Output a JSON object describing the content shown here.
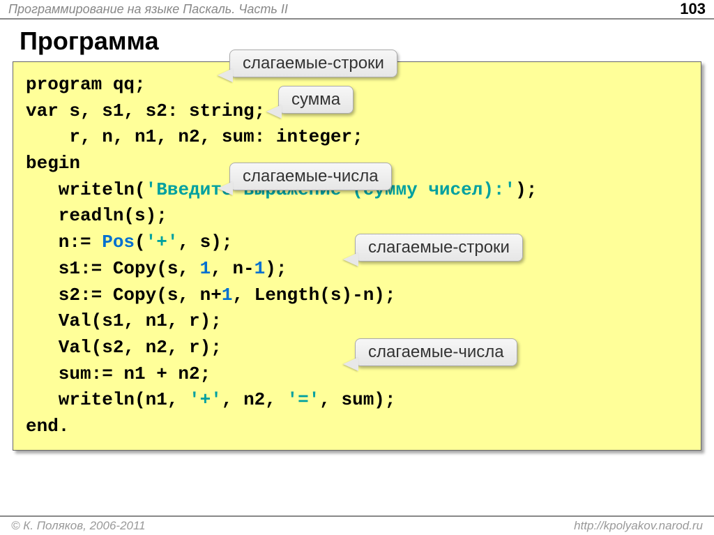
{
  "header": {
    "course": "Программирование на языке Паскаль. Часть II",
    "page": "103"
  },
  "title": "Программа",
  "code": {
    "l1": "program qq;",
    "l2": "var s, s1, s2: string;",
    "l3": "    r, n, n1, n2, sum: integer;",
    "l4": "begin",
    "l5a": "   writeln(",
    "l5b": "'Введите выражение (сумму чисел):'",
    "l5c": ");",
    "l6": "   readln(s);",
    "l7a": "   n:= ",
    "l7b": "Pos",
    "l7c": "(",
    "l7d": "'+'",
    "l7e": ", s);",
    "l8a": "   s1:= Copy(s, ",
    "l8b": "1",
    "l8c": ", n-",
    "l8d": "1",
    "l8e": ");",
    "l9a": "   s2:= Copy(s, n+",
    "l9b": "1",
    "l9c": ", Length(s)-n);",
    "l10": "   Val(s1, n1, r);",
    "l11": "   Val(s2, n2, r);",
    "l12": "   sum:= n1 + n2;",
    "l13a": "   writeln(n1, ",
    "l13b": "'+'",
    "l13c": ", n2, ",
    "l13d": "'='",
    "l13e": ", sum);",
    "l14": "end."
  },
  "callouts": {
    "c1": "слагаемые-строки",
    "c2": "сумма",
    "c3": "слагаемые-числа",
    "c4": "слагаемые-строки",
    "c5": "слагаемые-числа"
  },
  "footer": {
    "copyright": "© К. Поляков, 2006-2011",
    "url": "http://kpolyakov.narod.ru"
  }
}
